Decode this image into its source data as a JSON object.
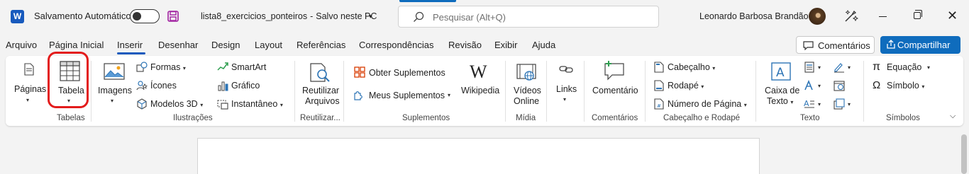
{
  "titlebar": {
    "app_icon": "word-icon",
    "app_letter": "W",
    "autosave_label": "Salvamento Automático",
    "autosave_on": false,
    "doc_name": "lista8_exercicios_ponteiros",
    "doc_sep": "-",
    "doc_status": "Salvo neste PC",
    "search_placeholder": "Pesquisar (Alt+Q)",
    "user_name": "Leonardo Barbosa Brandão",
    "close_symbol": "✕"
  },
  "tabs": [
    {
      "label": "Arquivo"
    },
    {
      "label": "Página Inicial"
    },
    {
      "label": "Inserir"
    },
    {
      "label": "Desenhar"
    },
    {
      "label": "Design"
    },
    {
      "label": "Layout"
    },
    {
      "label": "Referências"
    },
    {
      "label": "Correspondências"
    },
    {
      "label": "Revisão"
    },
    {
      "label": "Exibir"
    },
    {
      "label": "Ajuda"
    }
  ],
  "active_tab": "Inserir",
  "actions": {
    "comments": "Comentários",
    "share": "Compartilhar"
  },
  "ribbon": {
    "paginas": "Páginas",
    "tabela": "Tabela",
    "imagens": "Imagens",
    "formas": "Formas",
    "icones": "Ícones",
    "modelos3d": "Modelos 3D",
    "smartart": "SmartArt",
    "grafico": "Gráfico",
    "instantaneo": "Instantâneo",
    "reutilizar_1": "Reutilizar",
    "reutilizar_2": "Arquivos",
    "obter_suplementos": "Obter Suplementos",
    "meus_suplementos": "Meus Suplementos",
    "wikipedia": "Wikipedia",
    "videos_1": "Vídeos",
    "videos_2": "Online",
    "links": "Links",
    "comentario": "Comentário",
    "cabecalho": "Cabeçalho",
    "rodape": "Rodapé",
    "numero_pagina": "Número de Página",
    "caixa_texto_1": "Caixa de",
    "caixa_texto_2": "Texto",
    "equacao": "Equação",
    "simbolo": "Símbolo"
  },
  "groups": {
    "tabelas": "Tabelas",
    "ilustracoes": "Ilustrações",
    "reutilizar": "Reutilizar...",
    "suplementos": "Suplementos",
    "midia": "Mídia",
    "comentarios": "Comentários",
    "cabecalho_rodape": "Cabeçalho e Rodapé",
    "texto": "Texto",
    "simbolos": "Símbolos"
  },
  "annotation": {
    "color": "#e31c1c",
    "target": "Tabela"
  },
  "colors": {
    "accent": "#185abd",
    "share_button": "#0f6cbd",
    "save_icon": "#a020a0"
  }
}
